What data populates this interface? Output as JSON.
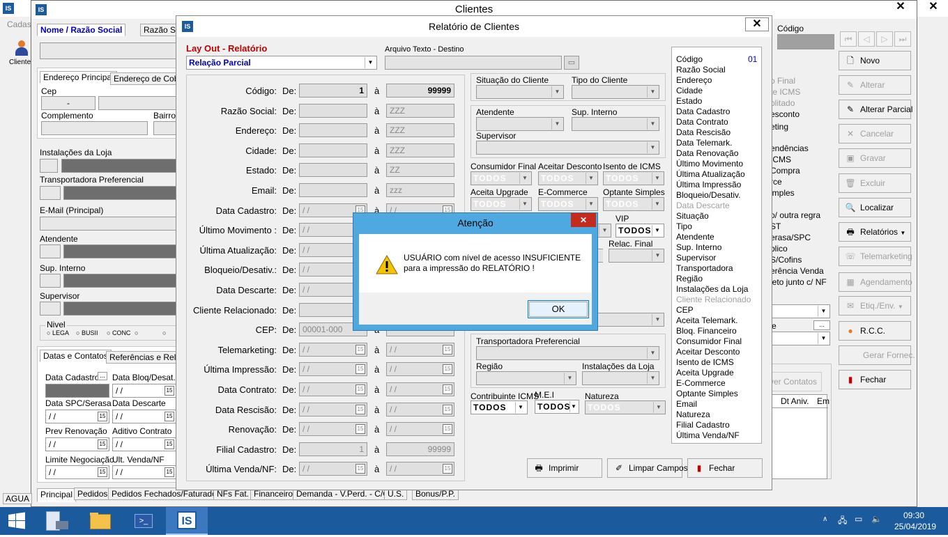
{
  "bg": {
    "title": "Clientes",
    "tab_cadas": "Cadas",
    "cliente_label": "Cliente",
    "tabs": [
      "Nome / Razão Social",
      "Razão So"
    ],
    "codigo_label": "Código",
    "addr_tabs": [
      "Endereço Principal",
      "Endereço de Cobra"
    ],
    "cep_label": "Cep",
    "cep_value": "-",
    "complemento_label": "Complemento",
    "bairro_label": "Bairro",
    "instalacoes_label": "Instalações da Loja",
    "transportadora_label": "Transportadora Preferencial",
    "email_label": "E-Mail (Principal)",
    "atendente_label": "Atendente",
    "sup_interno_label": "Sup. Interno",
    "supervisor_label": "Supervisor",
    "nivel_label": "Nivel",
    "nivel_opts": [
      "LEGA",
      "BUSII",
      "CONC",
      "",
      ""
    ],
    "sub_tabs": [
      "Datas e Contatos",
      "Referências e Relac"
    ],
    "dates": [
      {
        "l": "Data Cadastro",
        "v": ""
      },
      {
        "l": "Data Bloq/Desat.",
        "v": "/ /"
      },
      {
        "l": "Data SPC/Serasa",
        "v": "/ /"
      },
      {
        "l": "Data Descarte",
        "v": "/ /"
      },
      {
        "l": "Prev Renovação",
        "v": "/ /"
      },
      {
        "l": "Aditivo Contrato",
        "v": "/ /"
      },
      {
        "l": "Limite Negociação",
        "v": "/ /"
      },
      {
        "l": "Ult. Venda/NF",
        "v": "/ /"
      }
    ],
    "bottom_tabs": [
      "Principal",
      "Pedidos",
      "Pedidos Fechados/Faturados",
      "NFs Fat.",
      "Financeiro",
      "Demanda - V.Perd. - C/C",
      "U.S.",
      "Bonus/P.P."
    ],
    "agua": "AGUA",
    "right_buttons": [
      {
        "label": "Novo",
        "icon": "new-doc-icon",
        "enabled": true
      },
      {
        "label": "Alterar",
        "icon": "edit-icon",
        "enabled": false
      },
      {
        "label": "Alterar Parcial",
        "icon": "edit-partial-icon",
        "enabled": true
      },
      {
        "label": "Cancelar",
        "icon": "cancel-icon",
        "enabled": false
      },
      {
        "label": "Gravar",
        "icon": "save-icon",
        "enabled": false
      },
      {
        "label": "Excluir",
        "icon": "trash-icon",
        "enabled": false
      },
      {
        "label": "Localizar",
        "icon": "search-icon",
        "enabled": true
      },
      {
        "label": "Relatórios",
        "icon": "printer-icon",
        "enabled": true
      },
      {
        "label": "Telemarketing",
        "icon": "phone-icon",
        "enabled": false
      },
      {
        "label": "Agendamento",
        "icon": "calendar-icon",
        "enabled": false
      },
      {
        "label": "Etiq./Env.",
        "icon": "envelope-icon",
        "enabled": false
      },
      {
        "label": "R.C.C.",
        "icon": "person-icon",
        "enabled": true
      },
      {
        "label": "Gerar Fornec.",
        "icon": "",
        "enabled": false
      },
      {
        "label": "Fechar",
        "icon": "exit-icon",
        "enabled": true
      }
    ],
    "right_list": [
      "o Final",
      "te ICMS",
      "plitado",
      "esconto",
      "eting",
      "",
      "endências",
      "ICMS",
      "Compra",
      "rce",
      "imples",
      "",
      "o/ outra regra",
      "ST",
      "erasa/SPC",
      "blico",
      "S/Cofins",
      "erência Venda",
      "leto junto c/ NF"
    ],
    "nover_contatos": "ver Contatos",
    "grid_headers": [
      "Dt Aniv.",
      "Em"
    ],
    "ellipsis": "...",
    "e_label": "e"
  },
  "report": {
    "title": "Relatório de Clientes",
    "layout_label": "Lay Out - Relatório",
    "layout_value": "Relação Parcial",
    "arquivo_label": "Arquivo Texto - Destino",
    "de": "De:",
    "a": "à",
    "rows": [
      {
        "label": "Código:",
        "from": "1",
        "to": "99999",
        "kind": "num"
      },
      {
        "label": "Razão Social:",
        "from": "",
        "to": "ZZZ",
        "kind": "text"
      },
      {
        "label": "Endereço:",
        "from": "",
        "to": "ZZZ",
        "kind": "text"
      },
      {
        "label": "Cidade:",
        "from": "",
        "to": "ZZZ",
        "kind": "text"
      },
      {
        "label": "Estado:",
        "from": "",
        "to": "ZZ",
        "kind": "text"
      },
      {
        "label": "Email:",
        "from": "",
        "to": "zzz",
        "kind": "text"
      },
      {
        "label": "Data Cadastro:",
        "from": "/ /",
        "to": "/ /",
        "kind": "date"
      },
      {
        "label": "Último Movimento :",
        "from": "/ /",
        "to": "",
        "kind": "date"
      },
      {
        "label": "Última Atualização:",
        "from": "/ /",
        "to": "",
        "kind": "date"
      },
      {
        "label": "Bloqueio/Desativ.:",
        "from": "/ /",
        "to": "",
        "kind": "date"
      },
      {
        "label": "Data Descarte:",
        "from": "/ /",
        "to": "",
        "kind": "date"
      },
      {
        "label": "Cliente Relacionado:",
        "from": "",
        "to": "",
        "kind": "text"
      },
      {
        "label": "CEP:",
        "from": "00001-000",
        "to": "",
        "kind": "text"
      },
      {
        "label": "Telemarketing:",
        "from": "/ /",
        "to": "/ /",
        "kind": "date"
      },
      {
        "label": "Última Impressão:",
        "from": "/ /",
        "to": "/ /",
        "kind": "date"
      },
      {
        "label": "Data Contrato:",
        "from": "/ /",
        "to": "/ /",
        "kind": "date"
      },
      {
        "label": "Data Rescisão:",
        "from": "/ /",
        "to": "/ /",
        "kind": "date"
      },
      {
        "label": "Renovação:",
        "from": "/ /",
        "to": "/ /",
        "kind": "date"
      },
      {
        "label": "Filial Cadastro:",
        "from": "1",
        "to": "99999",
        "kind": "numg"
      },
      {
        "label": "Última Venda/NF:",
        "from": "/ /",
        "to": "/ /",
        "kind": "date"
      }
    ],
    "situacao_label": "Situação do Cliente",
    "tipo_label": "Tipo do Cliente",
    "atendente_label": "Atendente",
    "sup_interno_label": "Sup. Interno",
    "supervisor_label": "Supervisor",
    "flags": [
      {
        "label": "Consumidor Final",
        "value": "TODOS"
      },
      {
        "label": "Aceitar Desconto",
        "value": "TODOS"
      },
      {
        "label": "Isento de ICMS",
        "value": "TODOS"
      },
      {
        "label": "Aceita Upgrade",
        "value": "TODOS"
      },
      {
        "label": "E-Commerce",
        "value": "TODOS"
      },
      {
        "label": "Optante Simples",
        "value": "TODOS"
      }
    ],
    "vip_label": "VIP",
    "vip_value": "TODOS",
    "relac_final_label": "Relac. Final",
    "transportadora_label": "Transportadora Preferencial",
    "regiao_label": "Região",
    "instalacoes_label": "Instalações da Loja",
    "contribuinte_label": "Contribuinte ICMS",
    "contribuinte_value": "TODOS",
    "mei_label": "M.E.I",
    "mei_value": "TODOS",
    "natureza_label": "Natureza",
    "natureza_value": "TODOS",
    "field_list_num": "01",
    "field_list": [
      {
        "t": "Código",
        "g": false
      },
      {
        "t": "Razão Social",
        "g": false
      },
      {
        "t": "Endereço",
        "g": false
      },
      {
        "t": "Cidade",
        "g": false
      },
      {
        "t": "Estado",
        "g": false
      },
      {
        "t": "Data Cadastro",
        "g": false
      },
      {
        "t": "Data Contrato",
        "g": false
      },
      {
        "t": "Data Rescisão",
        "g": false
      },
      {
        "t": "Data Telemark.",
        "g": false
      },
      {
        "t": "Data Renovação",
        "g": false
      },
      {
        "t": "Último Movimento",
        "g": false
      },
      {
        "t": "Última Atualização",
        "g": false
      },
      {
        "t": "Última Impressão",
        "g": false
      },
      {
        "t": "Bloqueio/Desativ.",
        "g": false
      },
      {
        "t": "Data Descarte",
        "g": true
      },
      {
        "t": "Situação",
        "g": false
      },
      {
        "t": "Tipo",
        "g": false
      },
      {
        "t": "Atendente",
        "g": false
      },
      {
        "t": "Sup. Interno",
        "g": false
      },
      {
        "t": "Supervisor",
        "g": false
      },
      {
        "t": "Transportadora",
        "g": false
      },
      {
        "t": "Região",
        "g": false
      },
      {
        "t": "Instalações da Loja",
        "g": false
      },
      {
        "t": "Cliente Relacionado",
        "g": true
      },
      {
        "t": "CEP",
        "g": false
      },
      {
        "t": "Aceita Telemark.",
        "g": false
      },
      {
        "t": "Bloq. Financeiro",
        "g": false
      },
      {
        "t": "Consumidor Final",
        "g": false
      },
      {
        "t": "Aceitar Desconto",
        "g": false
      },
      {
        "t": "Isento de ICMS",
        "g": false
      },
      {
        "t": "Aceita Upgrade",
        "g": false
      },
      {
        "t": "E-Commerce",
        "g": false
      },
      {
        "t": "Optante Simples",
        "g": false
      },
      {
        "t": "Email",
        "g": false
      },
      {
        "t": "Natureza",
        "g": false
      },
      {
        "t": "Filial Cadastro",
        "g": false
      },
      {
        "t": "Última Venda/NF",
        "g": false
      }
    ],
    "btn_imprimir": "Imprimir",
    "btn_limpar": "Limpar Campos",
    "btn_fechar": "Fechar"
  },
  "alert": {
    "title": "Atenção",
    "message_line1": "USUÁRIO com nível de acesso INSUFICIENTE",
    "message_line2": "para a impressão do RELATÓRIO !",
    "ok": "OK"
  },
  "taskbar": {
    "time": "09:30",
    "date": "25/04/2019",
    "app_label": "IS"
  },
  "colors": {
    "accent_red": "#c00000",
    "accent_blue": "#0000c0",
    "dialog_frame": "#4fa8e0",
    "taskbar": "#1c5a9e",
    "close_red": "#c42b1c"
  }
}
